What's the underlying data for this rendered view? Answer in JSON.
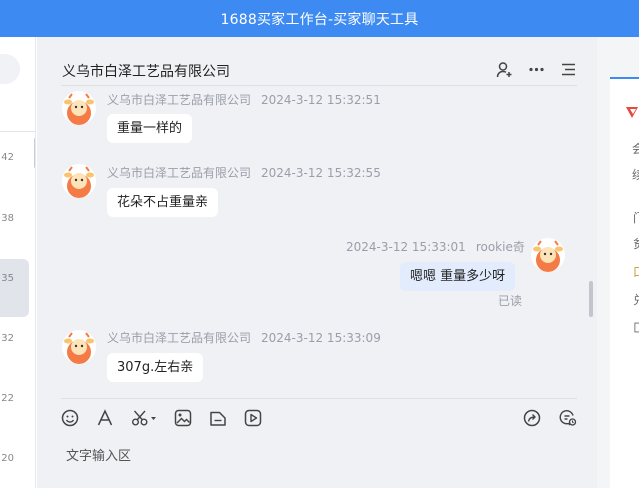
{
  "window": {
    "title": "1688买家工作台-买家聊天工具"
  },
  "left": {
    "times": [
      "42",
      "38",
      "35",
      "32",
      "22",
      "20"
    ]
  },
  "chat": {
    "title": "义乌市白泽工艺品有限公司",
    "messages": [
      {
        "sender": "义乌市白泽工艺品有限公司",
        "time": "2024-3-12 15:32:51",
        "text": "重量一样的"
      },
      {
        "sender": "义乌市白泽工艺品有限公司",
        "time": "2024-3-12 15:32:55",
        "text": "花朵不占重量亲"
      },
      {
        "sender": "rookie奇",
        "time": "2024-3-12 15:33:01",
        "text": "嗯嗯  重量多少呀",
        "status": "已读"
      },
      {
        "sender": "义乌市白泽工艺品有限公司",
        "time": "2024-3-12 15:33:09",
        "text": "307g.左右亲"
      }
    ],
    "input_placeholder": "文字输入区"
  },
  "right": {
    "chars": [
      "会",
      "续",
      "门",
      "贫",
      "口",
      "兑",
      "匚"
    ]
  },
  "colors": {
    "accent": "#3d8bf2",
    "avatar": "#f47b46"
  }
}
